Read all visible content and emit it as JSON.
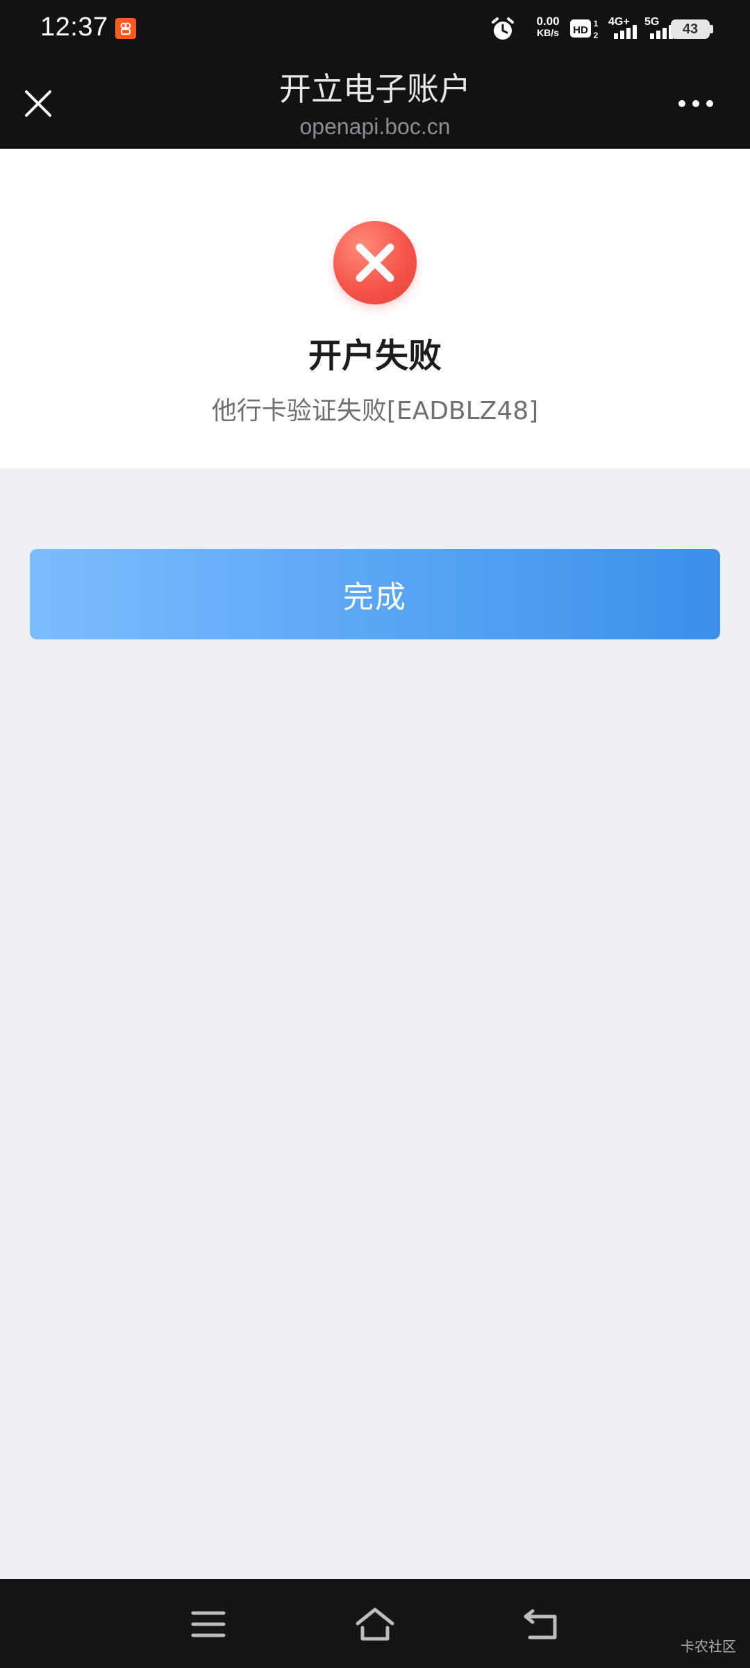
{
  "status_bar": {
    "time": "12:37",
    "net_speed_value": "0.00",
    "net_speed_unit": "KB/s",
    "network_4g": "4G+",
    "network_5g": "5G",
    "battery": "43",
    "icons": [
      "app-badge-icon",
      "alarm-icon",
      "hd-icon",
      "signal-4g-icon",
      "signal-5g-icon",
      "battery-icon"
    ]
  },
  "title_bar": {
    "title": "开立电子账户",
    "url": "openapi.boc.cn",
    "close_icon": "close-icon",
    "more_icon": "more-icon"
  },
  "result": {
    "status_icon": "error-x-icon",
    "title": "开户失败",
    "description": "他行卡验证失败[EADBLZ48]"
  },
  "actions": {
    "done_label": "完成"
  },
  "nav_bar": {
    "icons": [
      "menu-icon",
      "home-icon",
      "back-icon"
    ],
    "watermark": "卡农社区"
  },
  "colors": {
    "top_bar": "#121215",
    "page_background": "#efeff5",
    "error_red": "#f5544a",
    "button_start": "#7bbcfd",
    "button_end": "#3b8fea"
  }
}
